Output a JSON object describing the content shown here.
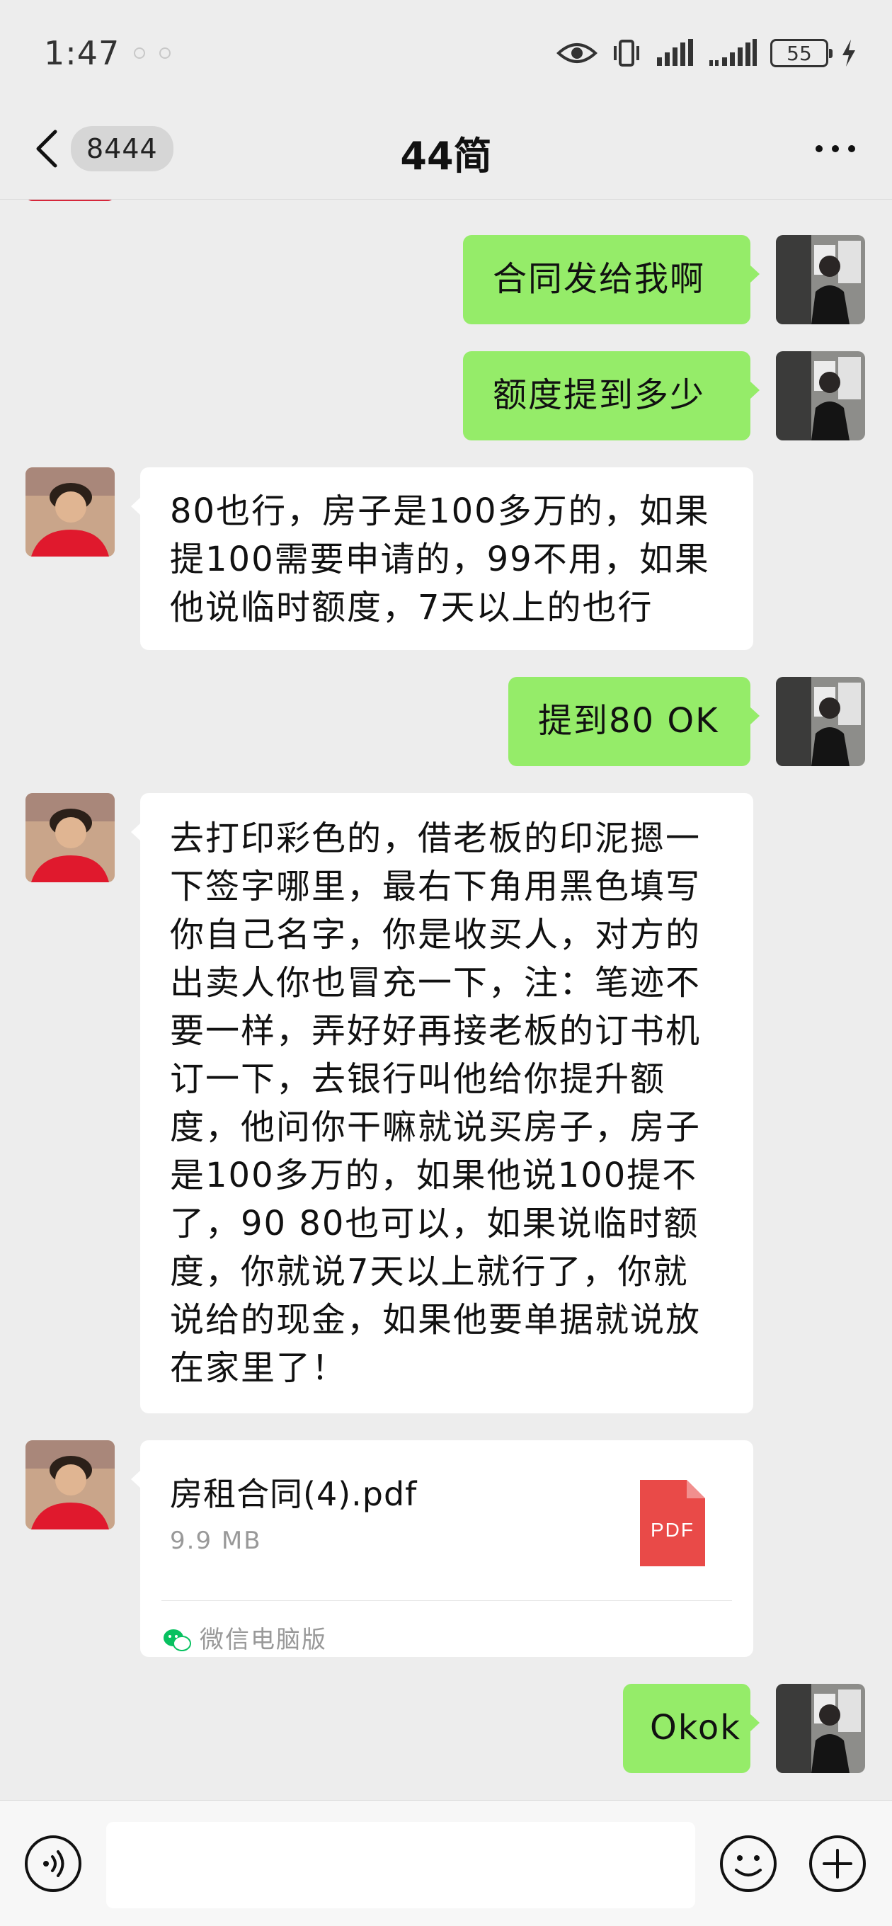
{
  "status_bar": {
    "time": "1:47",
    "battery": "55"
  },
  "header": {
    "unread_count": "8444",
    "title": "44简"
  },
  "messages": [
    {
      "id": "m1",
      "side": "right",
      "text": "合同发给我啊"
    },
    {
      "id": "m2",
      "side": "right",
      "text": "额度提到多少"
    },
    {
      "id": "m3",
      "side": "left",
      "lines": [
        "80也行，房子是100多万的，如果",
        "提100需要申请的，99不用，如果",
        "他说临时额度，7天以上的也行"
      ]
    },
    {
      "id": "m4",
      "side": "right",
      "text": "提到80 OK"
    },
    {
      "id": "m5",
      "side": "left",
      "lines": [
        "去打印彩色的，借老板的印泥摁一",
        "下签字哪里，最右下角用黑色填写",
        "你自己名字，你是收买人，对方的",
        "出卖人你也冒充一下，注：笔迹不",
        "要一样，弄好好再接老板的订书机",
        "订一下，去银行叫他给你提升额",
        "度，他问你干嘛就说买房子，房子",
        "是100多万的，如果他说100提不",
        "了，90 80也可以，如果说临时额",
        "度，你就说7天以上就行了，你就",
        "说给的现金，如果他要单据就说放",
        "在家里了！"
      ]
    },
    {
      "id": "m6",
      "side": "left",
      "type": "file",
      "file_name": "房租合同(4).pdf",
      "file_size": "9.9 MB",
      "source": "微信电脑版",
      "file_badge": "PDF"
    },
    {
      "id": "m7",
      "side": "right",
      "text": "Okok"
    }
  ],
  "colors": {
    "out_bubble": "#95ec69",
    "in_bubble": "#ffffff",
    "background": "#ededed",
    "pdf": "#e94a48",
    "wechat_green": "#07c160"
  },
  "icons": [
    "back-arrow-icon",
    "more-icon",
    "eye-icon",
    "vibrate-icon",
    "signal-icon",
    "charging-icon",
    "voice-icon",
    "emoji-icon",
    "plus-icon",
    "pdf-icon",
    "wechat-icon"
  ]
}
